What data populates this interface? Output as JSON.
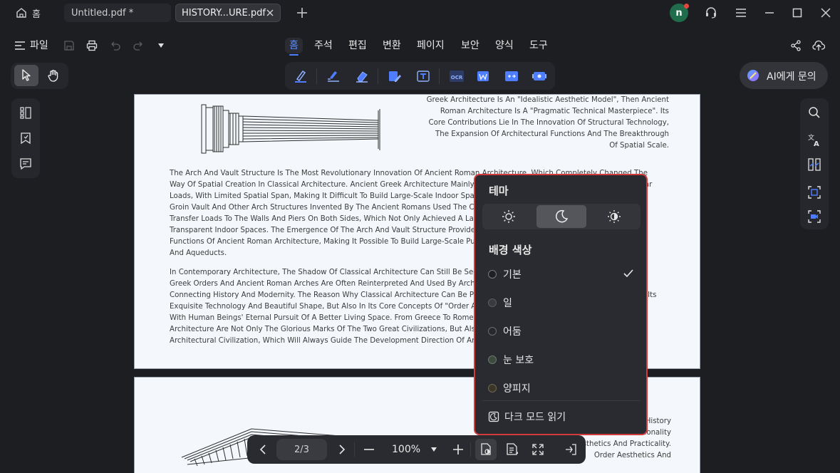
{
  "tabs": {
    "home_label": "홈",
    "items": [
      {
        "label": "Untitled.pdf *"
      },
      {
        "label": "HISTORY...URE.pdf"
      }
    ]
  },
  "titlebar": {
    "avatar_letter": "n"
  },
  "toolbar": {
    "file_label": "파일",
    "menu": [
      "홈",
      "주석",
      "편집",
      "변환",
      "페이지",
      "보안",
      "양식",
      "도구"
    ],
    "ai_label": "AI에게 문의"
  },
  "document": {
    "page1": {
      "para_top": [
        "Greek Architecture Is An \"Idealistic Aesthetic Model\", Then Ancient",
        "Roman Architecture Is A \"Pragmatic Technical Masterpiece\". Its",
        "Core Contributions Lie In The Innovation Of Structural Technology,",
        "The Expansion Of Architectural Functions And The Breakthrough",
        "Of Spatial Scale."
      ],
      "para1": [
        "The Arch And Vault Structure Is The Most Revolutionary Innovation Of Ancient Roman Architecture, Which Completely Changed The",
        "Way Of Spatial Creation In Classical Architecture. Ancient Greek Architecture Mainly Adopted The Post-And-Lintel Structure In Similar",
        "Loads, With Limited Spatial Span, Making It Difficult To Build Large-Scale Indoor Spaces. The Semicircular Arch, Barrel Vault,",
        "Groin Vault And Other Arch Structures Invented By The Ancient Romans Used The Characteristics Of Arches To Evenly",
        "Transfer Loads To The Walls And Piers On Both Sides, Which Not Only Achieved A Large Span But Also Created Spacious And",
        "Transparent Indoor Spaces. The Emergence Of The Arch And Vault Structure Provided Technical Support For Expanding The",
        "Functions Of Ancient Roman Architecture, Making It Possible To Build Large-Scale Public Buildings Such As Basilicas, Baths",
        "And Aqueducts."
      ],
      "para2": [
        "In Contemporary Architecture, The Shadow Of Classical Architecture Can Still Be Seen Everywhere. Elements Such As Ancient",
        "Greek Orders And Ancient Roman Arches Are Often Reinterpreted And Used By Architects, Becoming A Bridge",
        "Connecting History And Modernity. The Reason Why Classical Architecture Can Be Passed Down Through The Ages Lies Not Only In Its",
        "Exquisite Technology And Beautiful Shape, But Also In Its Core Concepts Of \"Order And Harmony\", Which Are In Line",
        "With Human Beings' Eternal Pursuit Of A Better Living Space. From Greece To Rome, The Development Of Classical",
        "Architecture Are Not Only The Glorious Marks Of The Two Great Civilizations, But Also The Eternal Foundation Of Western",
        "Architectural Civilization, Which Will Always Guide The Development Direction Of Architecture."
      ]
    },
    "page2": {
      "para": [
        "From Ancient Greece To Ancient Rome, The History",
        "Of Classical Architecture Shows The Rationality",
        "Aesthetics And Practicality.",
        "Order Aesthetics And"
      ]
    }
  },
  "popup": {
    "theme_heading": "테마",
    "bg_heading": "배경 색상",
    "options": [
      {
        "label": "기본",
        "color": "#1f2024",
        "checked": true
      },
      {
        "label": "일",
        "color": "#3a3b40",
        "checked": false
      },
      {
        "label": "어둠",
        "color": "#27282c",
        "checked": false
      },
      {
        "label": "눈 보호",
        "color": "#3d4a3e",
        "checked": false
      },
      {
        "label": "양피지",
        "color": "#3b3527",
        "checked": false
      }
    ],
    "dark_read_label": "다크 모드 읽기"
  },
  "bottombar": {
    "page_indicator": "2/3",
    "zoom": "100%"
  },
  "colors": {
    "accent": "#4f7dff",
    "popup_border": "#d33b3b",
    "avatar": "#1f6d4b"
  }
}
